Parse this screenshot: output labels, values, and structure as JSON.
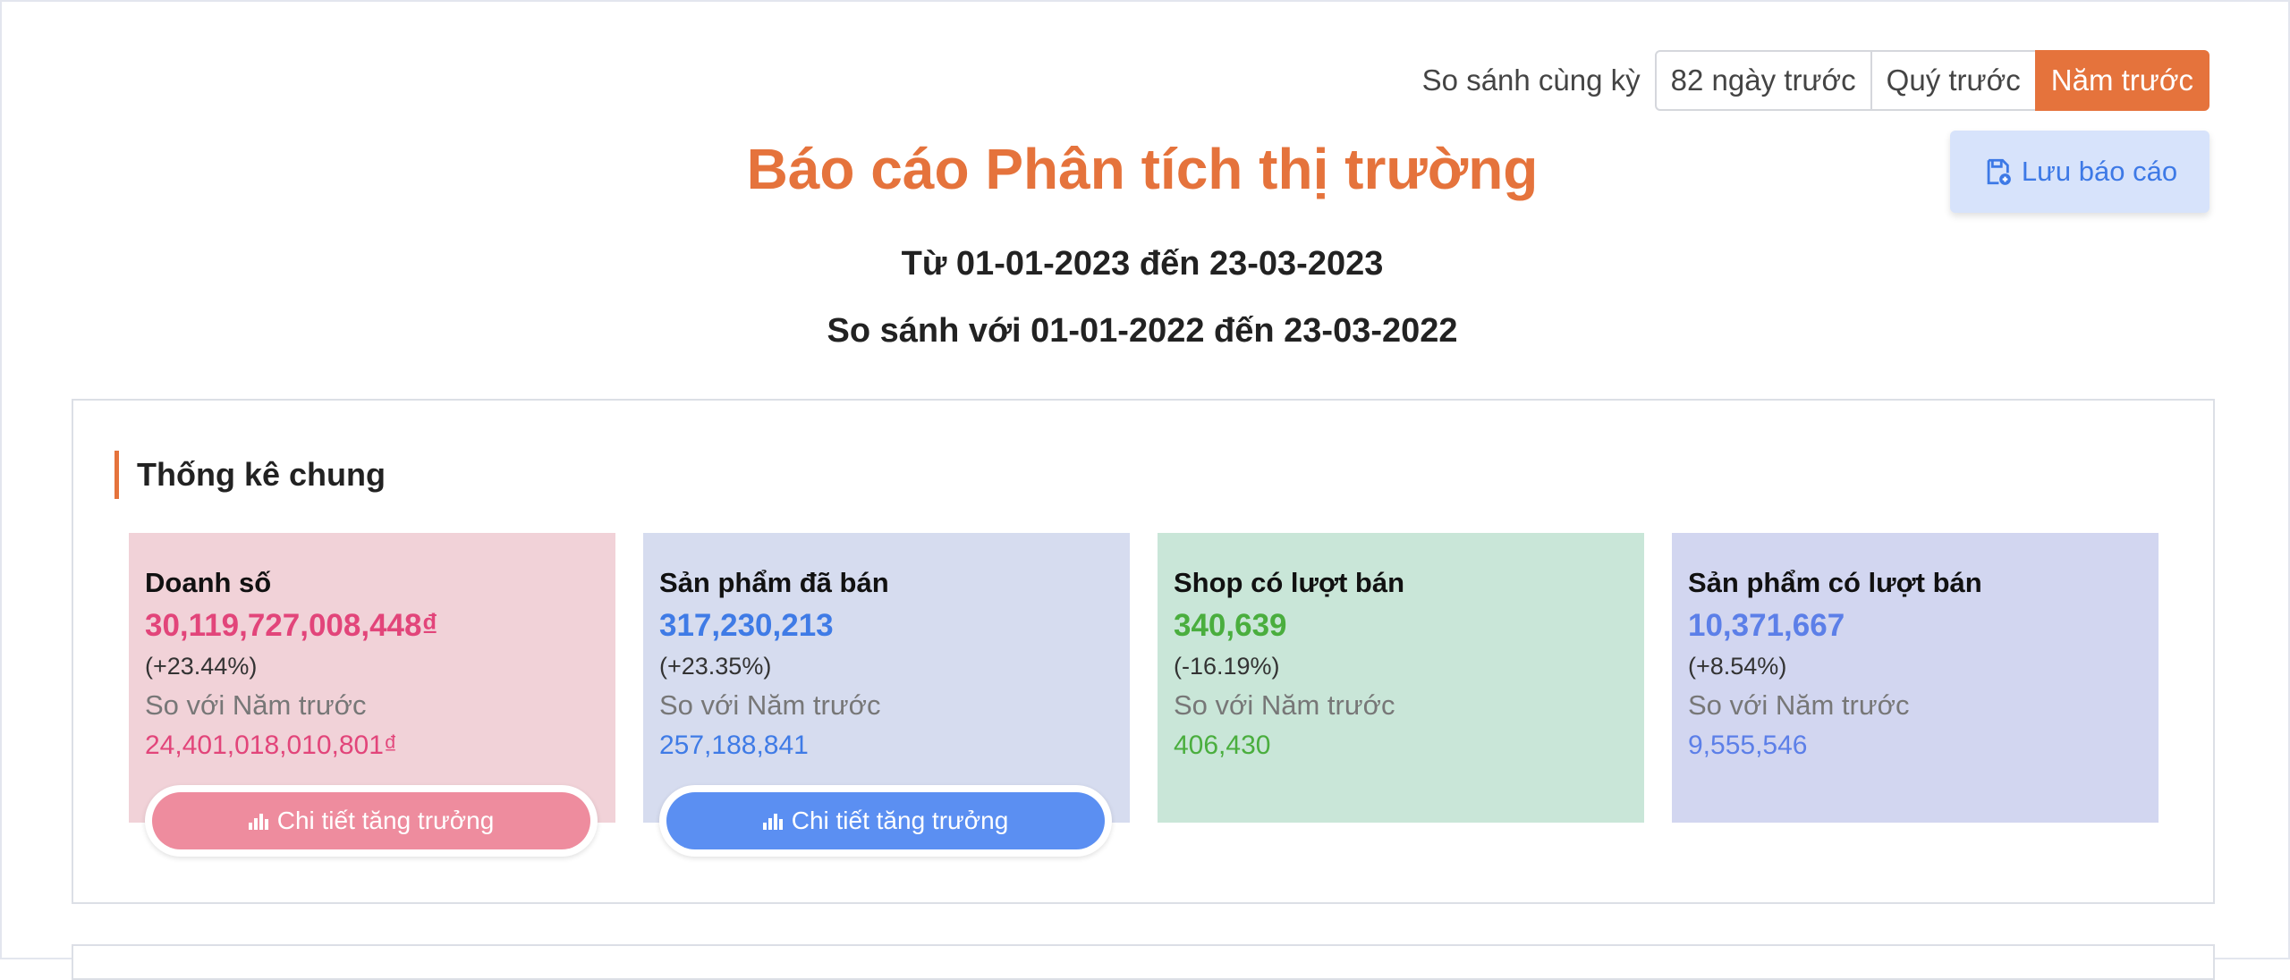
{
  "compare": {
    "label": "So sánh cùng kỳ",
    "options": [
      "82 ngày trước",
      "Quý trước",
      "Năm trước"
    ],
    "active": "Năm trước"
  },
  "save_button": {
    "label": "Lưu báo cáo",
    "icon": "save-icon"
  },
  "report": {
    "title": "Báo cáo Phân tích thị trường",
    "range": "Từ 01-01-2023 đến 23-03-2023",
    "compare_range": "So sánh với 01-01-2022 đến 23-03-2022"
  },
  "stats": {
    "section_title": "Thống kê chung",
    "cards": [
      {
        "label": "Doanh số",
        "value": "30,119,727,008,448₫",
        "change": "(+23.44%)",
        "compare_label": "So với Năm trước",
        "previous": "24,401,018,010,801₫",
        "color": "#e2457a"
      },
      {
        "label": "Sản phẩm đã bán",
        "value": "317,230,213",
        "change": "(+23.35%)",
        "compare_label": "So với Năm trước",
        "previous": "257,188,841",
        "color": "#3f7be6"
      },
      {
        "label": "Shop có lượt bán",
        "value": "340,639",
        "change": "(-16.19%)",
        "compare_label": "So với Năm trước",
        "previous": "406,430",
        "color": "#4aae3e"
      },
      {
        "label": "Sản phẩm có lượt bán",
        "value": "10,371,667",
        "change": "(+8.54%)",
        "compare_label": "So với Năm trước",
        "previous": "9,555,546",
        "color": "#5c7fe8"
      }
    ],
    "growth_button_label": "Chi tiết tăng trưởng"
  },
  "colors": {
    "accent": "#e5733c",
    "save_bg": "#d7e3fb"
  }
}
